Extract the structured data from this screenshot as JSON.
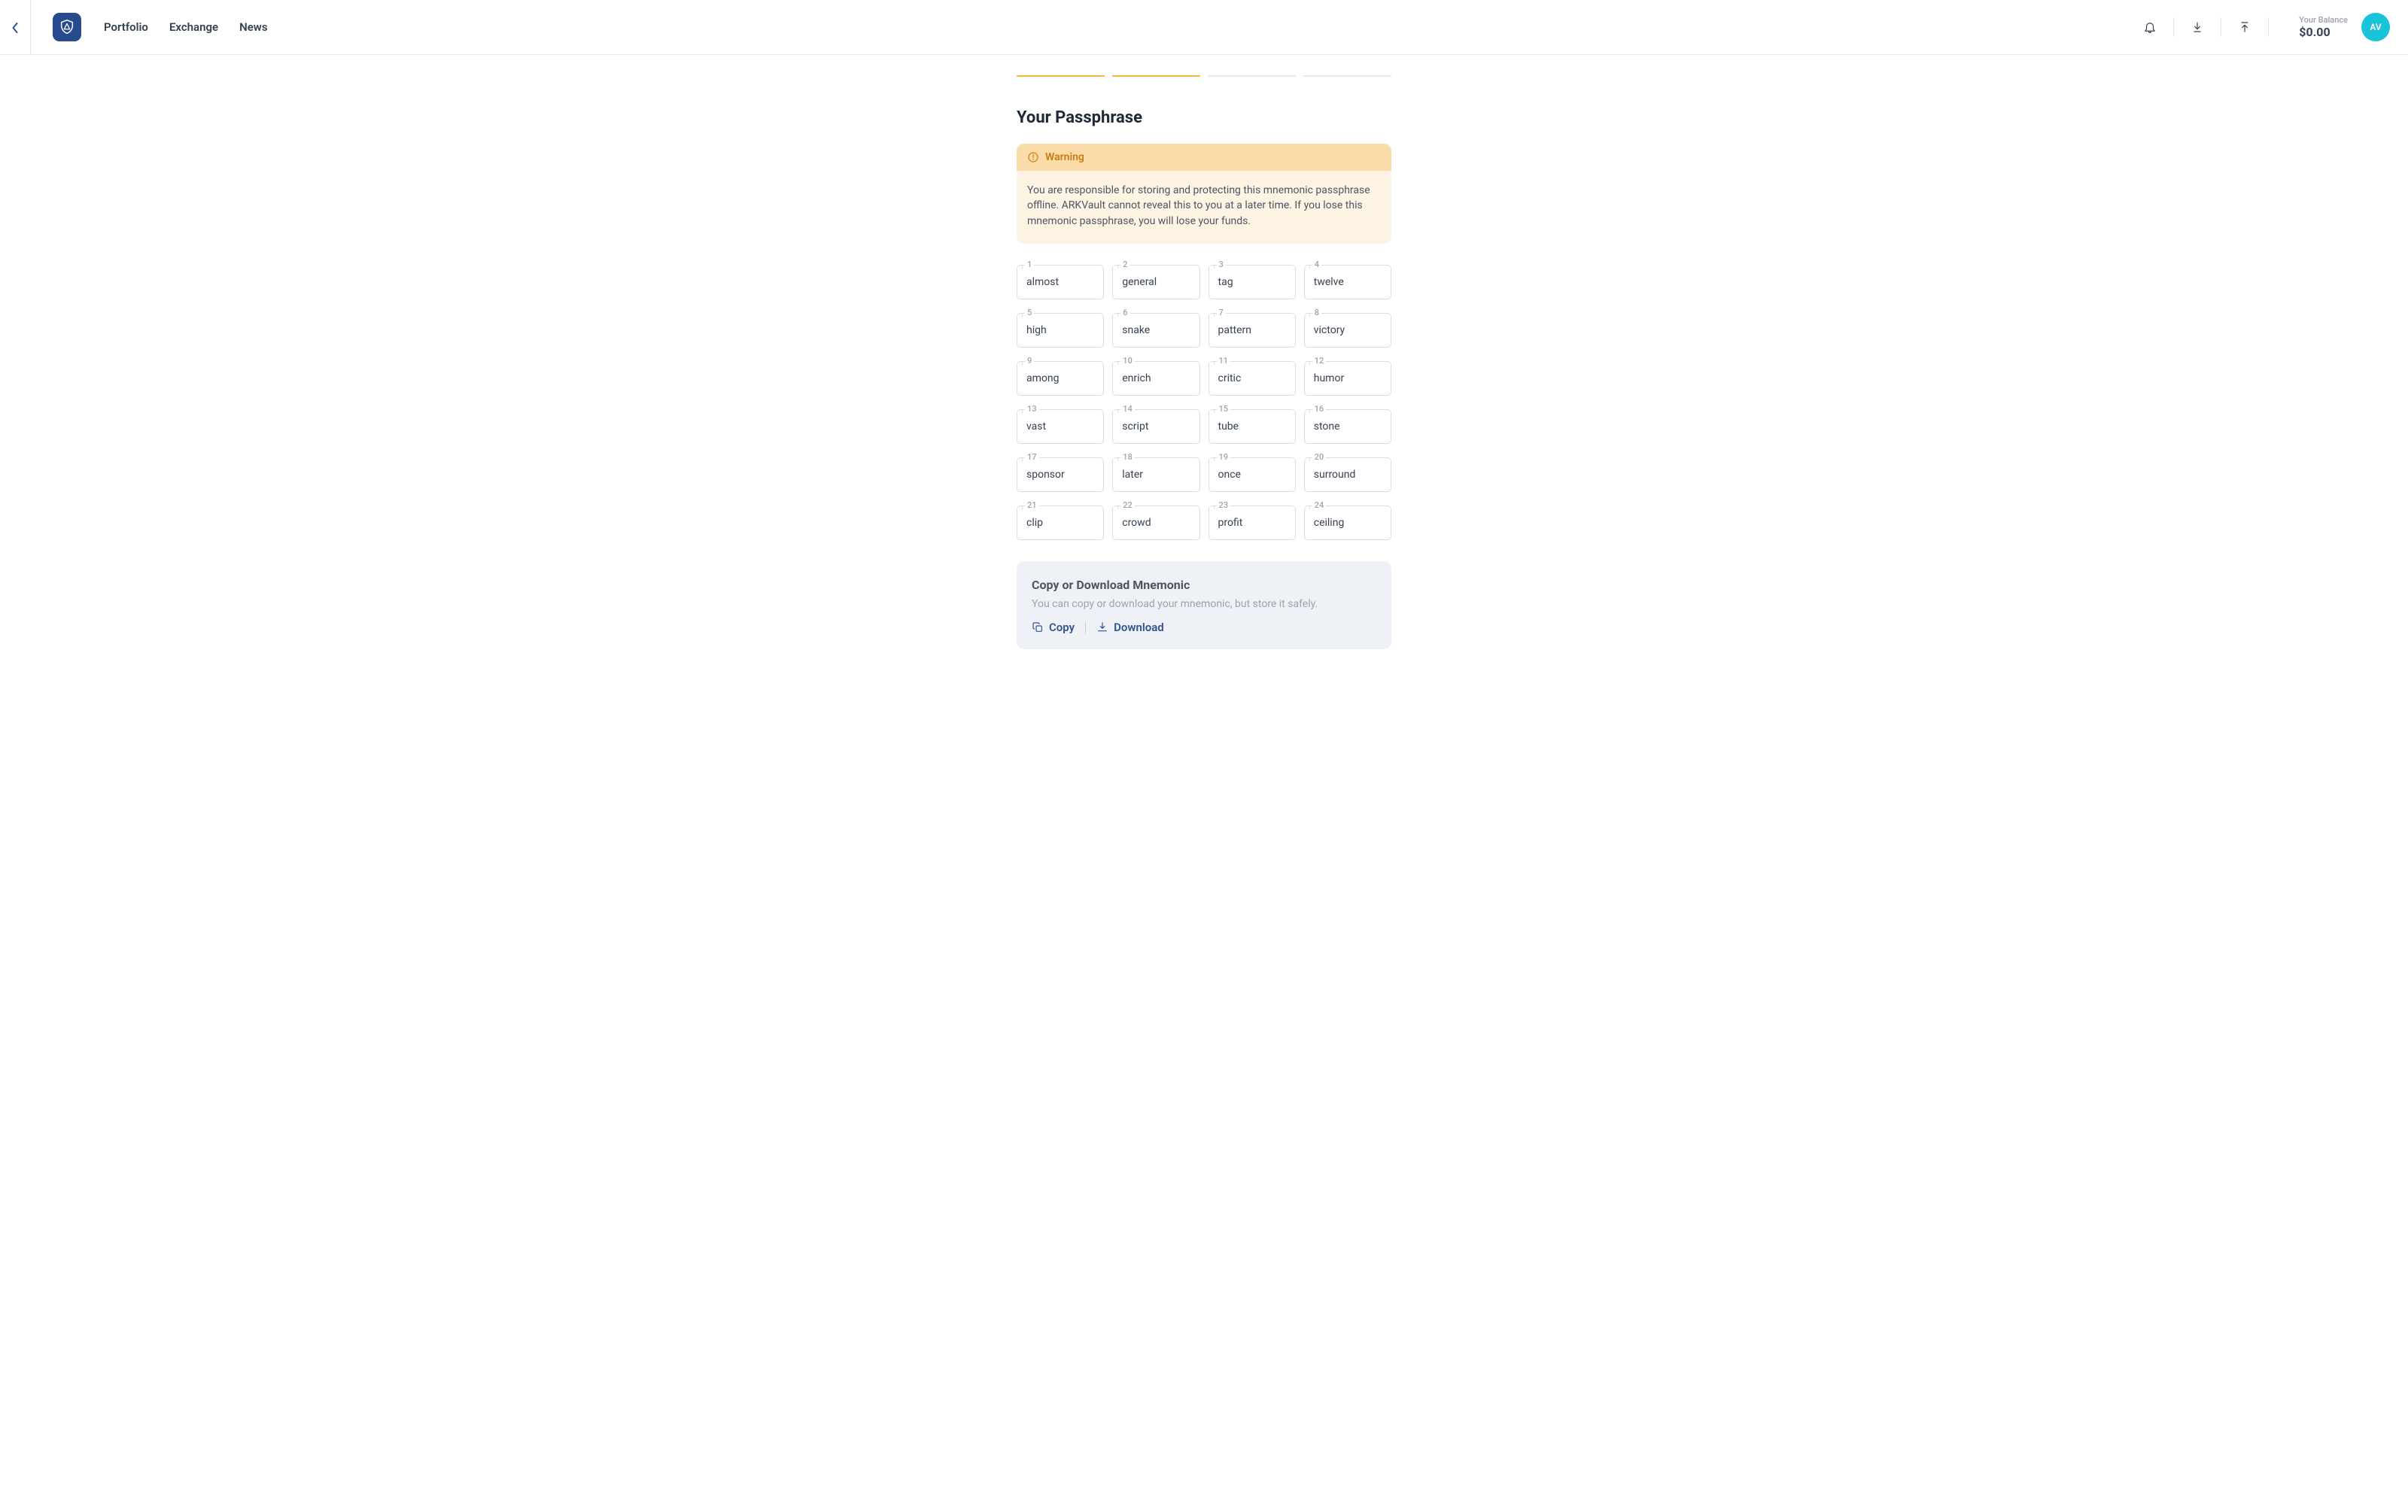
{
  "nav": {
    "links": [
      "Portfolio",
      "Exchange",
      "News"
    ],
    "balance_label": "Your Balance",
    "balance_value": "$0.00",
    "avatar_initials": "AV"
  },
  "page": {
    "title": "Your Passphrase",
    "progress_total": 4,
    "progress_done": 2
  },
  "warning": {
    "label": "Warning",
    "body": "You are responsible for storing and protecting this mnemonic passphrase offline. ARKVault cannot reveal this to you at a later time. If you lose this mnemonic passphrase, you will lose your funds."
  },
  "mnemonic": {
    "words": [
      "almost",
      "general",
      "tag",
      "twelve",
      "high",
      "snake",
      "pattern",
      "victory",
      "among",
      "enrich",
      "critic",
      "humor",
      "vast",
      "script",
      "tube",
      "stone",
      "sponsor",
      "later",
      "once",
      "surround",
      "clip",
      "crowd",
      "profit",
      "ceiling"
    ]
  },
  "copy_panel": {
    "title": "Copy or Download Mnemonic",
    "desc": "You can copy or download your mnemonic, but store it safely.",
    "copy_label": "Copy",
    "download_label": "Download"
  }
}
